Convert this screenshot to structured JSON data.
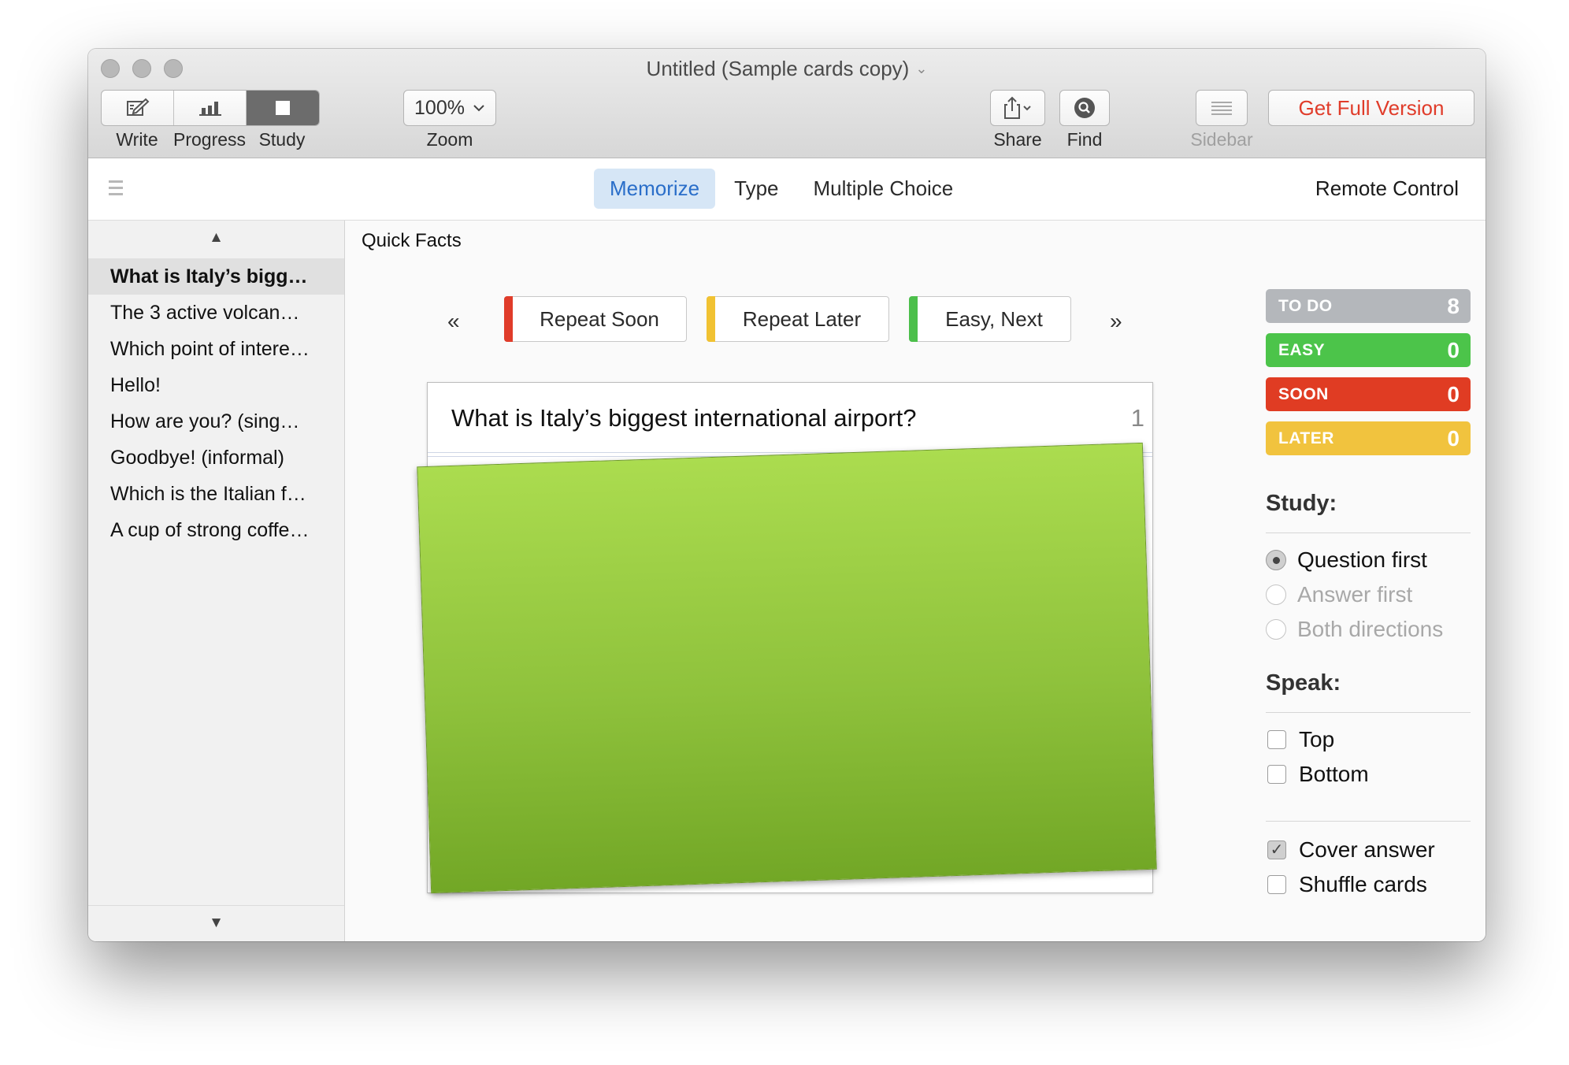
{
  "window": {
    "title": "Untitled (Sample cards copy)",
    "title_chevron": "⌄"
  },
  "toolbar": {
    "write_label": "Write",
    "progress_label": "Progress",
    "study_label": "Study",
    "zoom_value": "100%",
    "zoom_label": "Zoom",
    "share_label": "Share",
    "find_label": "Find",
    "sidebar_label": "Sidebar",
    "full_version_label": "Get Full Version"
  },
  "modes": [
    {
      "label": "Memorize",
      "active": true
    },
    {
      "label": "Type",
      "active": false
    },
    {
      "label": "Multiple Choice",
      "active": false
    }
  ],
  "remote_control_label": "Remote Control",
  "sidebar": {
    "up_arrow": "▲",
    "down_arrow": "▼",
    "items": [
      {
        "label": "What is Italy’s bigg…",
        "selected": true
      },
      {
        "label": "The 3 active volcan…",
        "selected": false
      },
      {
        "label": "Which point of intere…",
        "selected": false
      },
      {
        "label": "Hello!",
        "selected": false
      },
      {
        "label": "How are you? (sing…",
        "selected": false
      },
      {
        "label": "Goodbye! (informal)",
        "selected": false
      },
      {
        "label": "Which is the Italian f…",
        "selected": false
      },
      {
        "label": "A cup of strong coffe…",
        "selected": false
      }
    ]
  },
  "main": {
    "section_title": "Quick Facts",
    "prev_arrow": "«",
    "next_arrow": "»",
    "rating_buttons": [
      {
        "label": "Repeat Soon",
        "color": "#e03c2a"
      },
      {
        "label": "Repeat Later",
        "color": "#f1c232"
      },
      {
        "label": "Easy, Next",
        "color": "#4cbf4b"
      }
    ],
    "card": {
      "question": "What is Italy’s biggest international airport?",
      "number": "1",
      "cover_color": "#8fc23c"
    }
  },
  "stats": [
    {
      "label": "TO DO",
      "value": "8",
      "color": "#b4b7bb"
    },
    {
      "label": "EASY",
      "value": "0",
      "color": "#4cc44a"
    },
    {
      "label": "SOON",
      "value": "0",
      "color": "#e03c23"
    },
    {
      "label": "LATER",
      "value": "0",
      "color": "#f1c33e"
    }
  ],
  "study": {
    "heading": "Study:",
    "options": [
      {
        "label": "Question first",
        "selected": true,
        "enabled": true
      },
      {
        "label": "Answer first",
        "selected": false,
        "enabled": false
      },
      {
        "label": "Both directions",
        "selected": false,
        "enabled": false
      }
    ]
  },
  "speak": {
    "heading": "Speak:",
    "options": [
      {
        "label": "Top",
        "checked": false
      },
      {
        "label": "Bottom",
        "checked": false
      }
    ]
  },
  "extra_options": [
    {
      "label": "Cover answer",
      "checked": true
    },
    {
      "label": "Shuffle cards",
      "checked": false
    }
  ]
}
